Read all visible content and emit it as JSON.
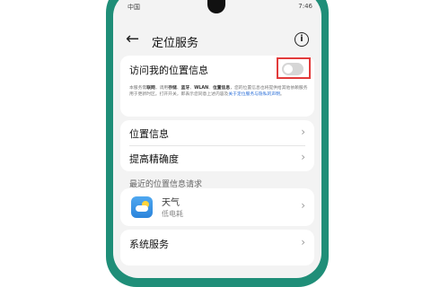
{
  "status_bar": {
    "carrier": "中国",
    "time": "7:46"
  },
  "header": {
    "back_glyph": "←",
    "title": "定位服务",
    "info_glyph": "i"
  },
  "location_access": {
    "title": "访问我的位置信息",
    "toggle_on": false,
    "description_parts": [
      "本服务需",
      "联网",
      "，调用",
      "存储",
      "、",
      "蓝牙",
      "、",
      "WLAN",
      "、",
      "位置信息",
      "，您的位置信息也将提供给其他依赖服务用于更新时区。打开开关，即表示您同意上述内容及",
      "关于定位服务与隐私的声明",
      "。"
    ]
  },
  "settings": {
    "items": [
      {
        "label": "位置信息"
      },
      {
        "label": "提高精确度"
      }
    ]
  },
  "recent": {
    "section_title": "最近的位置信息请求",
    "app_name": "天气",
    "app_sub": "低电耗"
  },
  "system": {
    "label": "系统服务"
  },
  "icons": {
    "chevron": "›"
  }
}
